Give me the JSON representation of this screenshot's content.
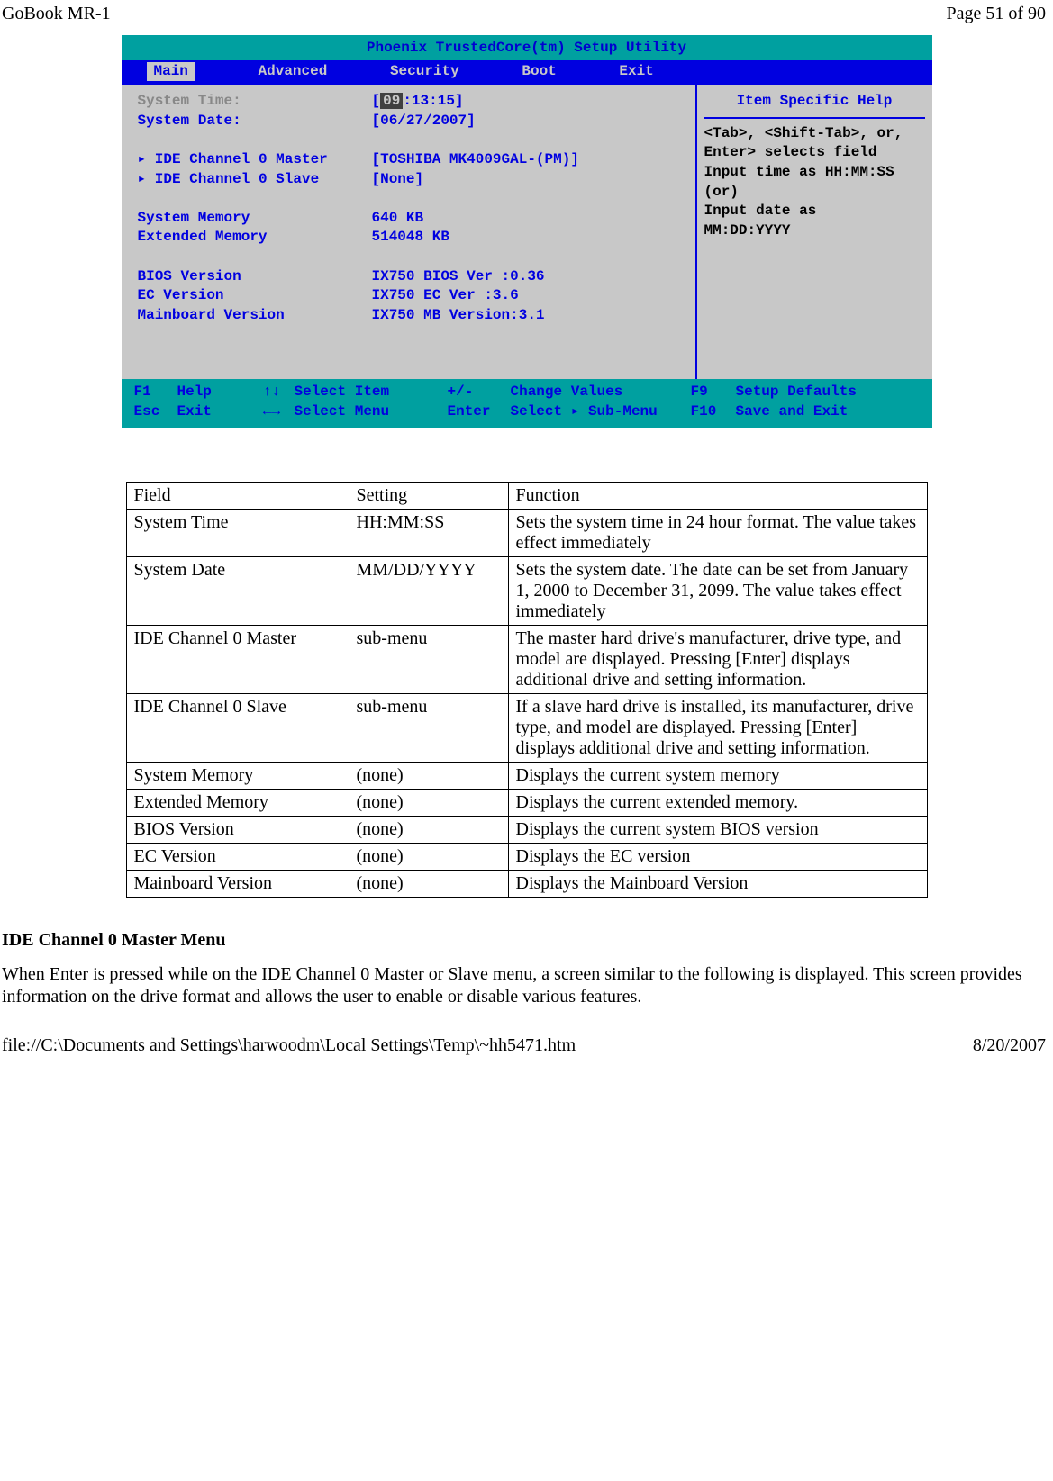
{
  "header": {
    "left": "GoBook MR-1",
    "right": "Page 51 of 90"
  },
  "footer": {
    "left": "file://C:\\Documents and Settings\\harwoodm\\Local Settings\\Temp\\~hh5471.htm",
    "right": "8/20/2007"
  },
  "bios": {
    "title": "Phoenix TrustedCore(tm) Setup Utility",
    "tabs": {
      "main": "Main",
      "advanced": "Advanced",
      "security": "Security",
      "boot": "Boot",
      "exit": "Exit"
    },
    "rows": {
      "systime_label": "System Time:",
      "systime_val_pre": "[",
      "systime_hl": "09",
      "systime_val_post": ":13:15]",
      "sysdate_label": "System Date:",
      "sysdate_val": "[06/27/2007]",
      "ide0m_label": "▸ IDE Channel 0 Master",
      "ide0m_val": "[TOSHIBA MK4009GAL-(PM)]",
      "ide0s_label": "▸ IDE Channel 0 Slave",
      "ide0s_val": "[None]",
      "sysmem_label": "System Memory",
      "sysmem_val": "640 KB",
      "extmem_label": "Extended Memory",
      "extmem_val": "514048 KB",
      "biosver_label": "BIOS Version",
      "biosver_val": "IX750 BIOS Ver :0.36",
      "ecver_label": "EC Version",
      "ecver_val": "IX750 EC Ver :3.6",
      "mbver_label": "Mainboard Version",
      "mbver_val": "IX750 MB Version:3.1"
    },
    "help": {
      "title": "Item Specific Help",
      "l1": "<Tab>, <Shift-Tab>, or,",
      "l2": "Enter> selects field",
      "l3": "Input time as HH:MM:SS",
      "l4": "(or)",
      "l5": "Input date as",
      "l6": "MM:DD:YYYY"
    },
    "foot": {
      "f1": "F1",
      "help": "Help",
      "arr1": "↑↓",
      "sel_item": "Select Item",
      "pm": "+/-",
      "chg": "Change Values",
      "f9": "F9",
      "setup_def": "Setup Defaults",
      "esc": "Esc",
      "exit": "Exit",
      "arr2": "←→",
      "sel_menu": "Select Menu",
      "enter": "Enter",
      "sub": "Select ▸ Sub-Menu",
      "f10": "F10",
      "save": "Save and Exit"
    }
  },
  "table": {
    "h1": "Field",
    "h2": "Setting",
    "h3": "Function",
    "rows": [
      {
        "f": "System Time",
        "s": "HH:MM:SS",
        "d": "Sets the system time in 24 hour format. The value takes effect immediately"
      },
      {
        "f": "System Date",
        "s": "MM/DD/YYYY",
        "d": "Sets the system date. The date can be set from January 1, 2000 to December 31, 2099. The value takes effect immediately"
      },
      {
        "f": "IDE Channel 0 Master",
        "s": "sub-menu",
        "d": "The master hard drive's manufacturer, drive type, and model are displayed.  Pressing [Enter] displays additional drive and setting information."
      },
      {
        "f": "IDE Channel 0 Slave",
        "s": "sub-menu",
        "d": "If a slave hard drive is installed, its manufacturer, drive type, and model are displayed.  Pressing [Enter] displays additional drive and setting information."
      },
      {
        "f": "System Memory",
        "s": "(none)",
        "d": "Displays the current system memory"
      },
      {
        "f": "Extended Memory",
        "s": "(none)",
        "d": "Displays the current extended memory."
      },
      {
        "f": "BIOS Version",
        "s": "(none)",
        "d": "Displays the current system BIOS version"
      },
      {
        "f": "EC Version",
        "s": "(none)",
        "d": "Displays the EC version"
      },
      {
        "f": "Mainboard Version",
        "s": "(none)",
        "d": "Displays the Mainboard Version"
      }
    ]
  },
  "section_heading": "IDE Channel 0 Master Menu",
  "section_body": "When Enter is pressed while on the IDE Channel 0 Master or Slave menu, a screen similar to the following is displayed.  This screen provides information on the drive format and allows the user to enable or disable various features."
}
